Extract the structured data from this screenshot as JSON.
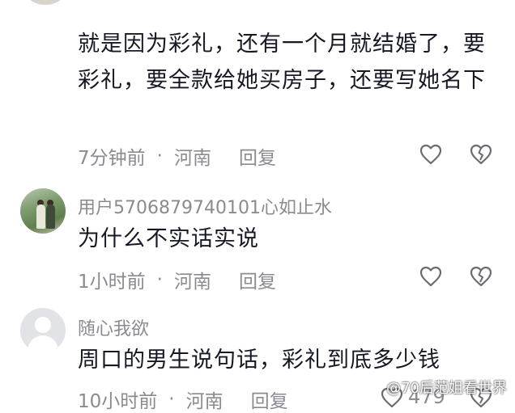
{
  "comments": [
    {
      "text": "就是因为彩礼，还有一个月就结婚了，要彩礼，要全款给她买房子，还要写她名下",
      "time": "7分钟前",
      "separator": "·",
      "location": "河南",
      "reply_label": "回复"
    },
    {
      "username": "用户5706879740101心如止水",
      "text": "为什么不实话实说",
      "time": "1小时前",
      "separator": "·",
      "location": "河南",
      "reply_label": "回复"
    },
    {
      "username": "随心我欲",
      "text": "周口的男生说句话，彩礼到底多少钱",
      "time": "10小时前",
      "separator": "·",
      "location": "河南",
      "reply_label": "回复",
      "like_count": "479"
    }
  ],
  "watermark": "@70后范姐看世界",
  "icons": {
    "like": "heart-outline-icon",
    "dislike": "broken-heart-icon",
    "avatar_default": "default-user-icon"
  },
  "colors": {
    "text": "#161823",
    "meta": "#8a8b91"
  }
}
